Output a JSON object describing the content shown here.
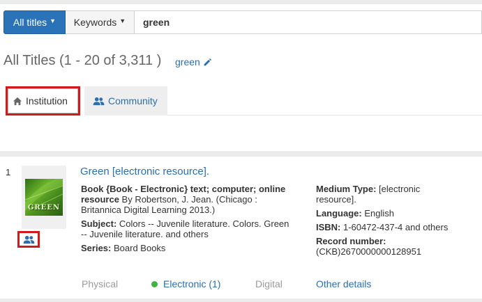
{
  "search": {
    "scope_label": "All titles",
    "field_label": "Keywords",
    "query": "green"
  },
  "results": {
    "title": "All Titles (1 - 20 of 3,311 )",
    "query_link": "green"
  },
  "tabs": [
    {
      "label": "Institution",
      "icon": "home-icon",
      "active": true
    },
    {
      "label": "Community",
      "icon": "users-icon",
      "active": false
    }
  ],
  "record": {
    "number": "1",
    "thumbnail_text": "GREEN",
    "title": "Green [electronic resource].",
    "format_bold": "Book {Book - Electronic} text; computer; online resource",
    "format_rest": " By Robertson, J. Jean. (Chicago : Britannica Digital Learning 2013.)",
    "subject_label": "Subject:",
    "subject_value": " Colors -- Juvenile literature. Colors. Green -- Juvenile literature. and others",
    "series_label": "Series:",
    "series_value": " Board Books",
    "medium_label": "Medium Type:",
    "medium_value": " [electronic resource].",
    "language_label": "Language:",
    "language_value": " English",
    "isbn_label": "ISBN:",
    "isbn_value": " 1-60472-437-4 and others",
    "record_number_label": "Record number:",
    "record_number_value": "(CKB)2670000000128951",
    "availability": {
      "physical": "Physical",
      "electronic": "Electronic (1)",
      "digital": "Digital",
      "other_details": "Other details"
    }
  },
  "colors": {
    "primary": "#2a73b8",
    "link": "#2a6fb0",
    "highlight_box": "#d11a1a",
    "available_dot": "#3eb33e"
  }
}
